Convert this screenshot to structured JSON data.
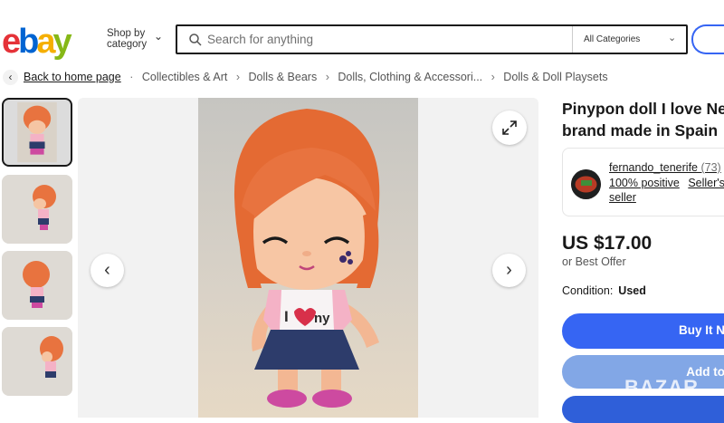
{
  "header": {
    "logo_alt": "ebay",
    "shop_by_line1": "Shop by",
    "shop_by_line2": "category",
    "search_placeholder": "Search for anything",
    "category_select": "All Categories"
  },
  "breadcrumb": {
    "home": "Back to home page",
    "items": [
      "Collectibles & Art",
      "Dolls & Bears",
      "Dolls, Clothing & Accessori...",
      "Dolls & Doll Playsets"
    ]
  },
  "listing": {
    "title_line1": "Pinypon doll I love Ne",
    "title_line2": "brand made in Spain",
    "price": "US $17.00",
    "best_offer": "or Best Offer",
    "condition_label": "Condition:",
    "condition_value": "Used"
  },
  "seller": {
    "name": "fernando_tenerife",
    "feedback_count": "(73)",
    "positive": "100% positive",
    "link_part": "Seller's",
    "line3": "seller"
  },
  "buttons": {
    "buy_now": "Buy It N",
    "add_to_cart": "Add to"
  },
  "watermark": "BAZAR",
  "colors": {
    "ebay_red": "#e53238",
    "ebay_blue": "#0064d2",
    "ebay_yellow": "#f5af02",
    "ebay_green": "#86b817",
    "primary_button": "#3665f3",
    "secondary_button": "#82a7e6"
  }
}
